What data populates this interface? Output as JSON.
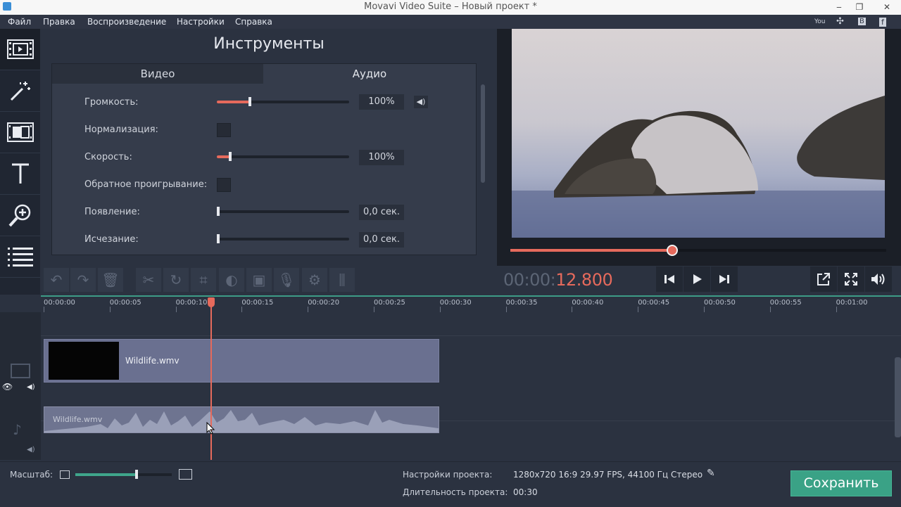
{
  "window": {
    "title": "Movavi Video Suite – Новый проект *",
    "controls": [
      "‒",
      "❐",
      "✕"
    ]
  },
  "menu": {
    "items": [
      "Файл",
      "Правка",
      "Воспроизведение",
      "Настройки",
      "Справка"
    ],
    "right_icons": [
      "youtube-icon",
      "social-icon",
      "vk-icon",
      "facebook-icon"
    ]
  },
  "left_toolbar": {
    "items": [
      "import-media",
      "filters",
      "transitions",
      "titles",
      "zoom-callout",
      "more-tools"
    ]
  },
  "tools": {
    "title": "Инструменты",
    "tabs": [
      "Видео",
      "Аудио"
    ],
    "active_tab": "Аудио",
    "properties": {
      "volume": {
        "label": "Громкость:",
        "value": "100%",
        "level": 0.25
      },
      "normalize": {
        "label": "Нормализация:",
        "checked": false
      },
      "speed": {
        "label": "Скорость:",
        "value": "100%",
        "level": 0.1
      },
      "reverse": {
        "label": "Обратное проигрывание:",
        "checked": false
      },
      "fade_in": {
        "label": "Появление:",
        "value": "0,0 сек.",
        "level": 0
      },
      "fade_out": {
        "label": "Исчезание:",
        "value": "0,0 сек.",
        "level": 0
      }
    }
  },
  "player": {
    "timecode_dim": "00:00:",
    "timecode_active": "12.800",
    "progress": 0.43
  },
  "timeline": {
    "ticks": [
      "00:00:00",
      "00:00:05",
      "00:00:10",
      "00:00:15",
      "00:00:20",
      "00:00:25",
      "00:00:30",
      "00:00:35",
      "00:00:40",
      "00:00:45",
      "00:00:50",
      "00:00:55",
      "00:01:00"
    ],
    "video_clip_name": "Wildlife.wmv",
    "audio_clip_name": "Wildlife.wmv"
  },
  "bottom": {
    "zoom_label": "Масштаб:",
    "zoom_level": 0.62,
    "project_settings_label": "Настройки проекта:",
    "project_settings_value": "1280x720 16:9 29.97 FPS, 44100 Гц Стерео",
    "duration_label": "Длительность проекта:",
    "duration_value": "00:30",
    "save_label": "Сохранить"
  },
  "colors": {
    "accent": "#e66a5c",
    "save": "#3aa286",
    "background": "#2b3240"
  }
}
